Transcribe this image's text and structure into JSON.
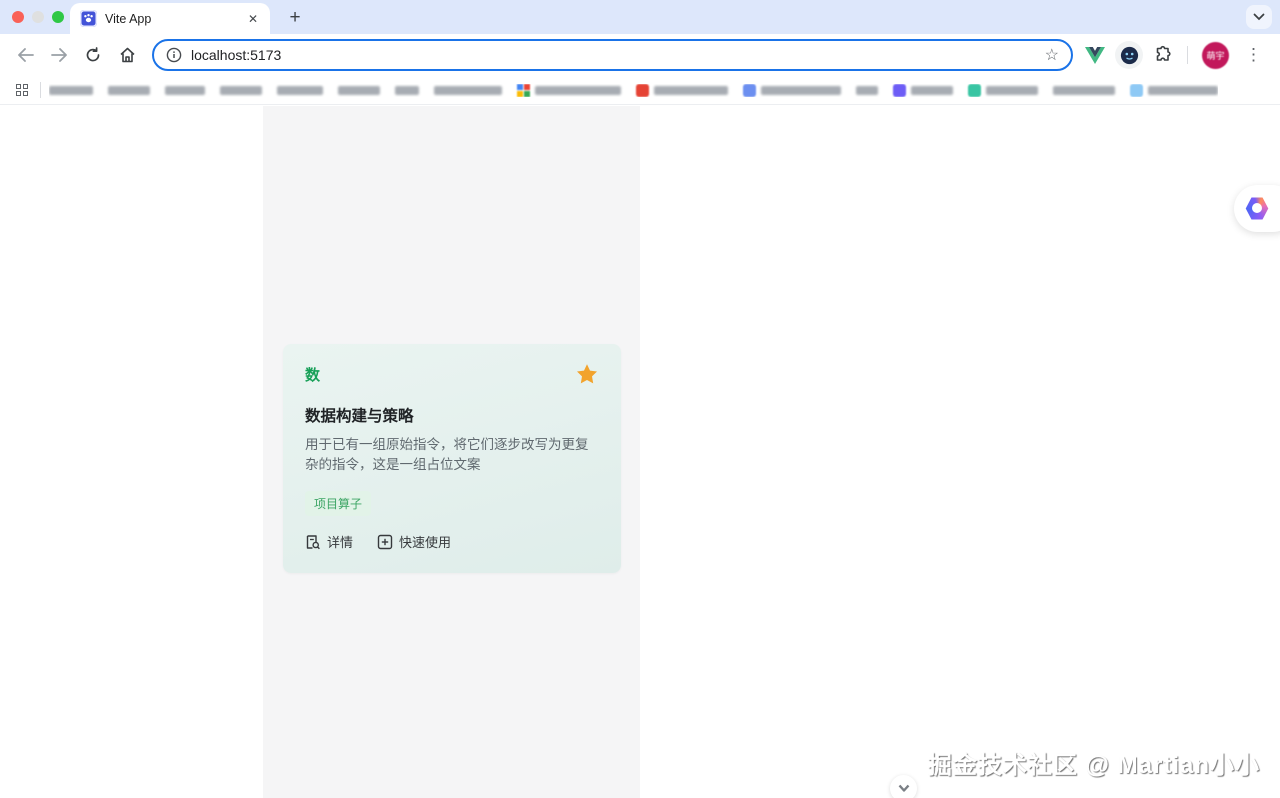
{
  "window": {
    "traffic_lights": [
      "close",
      "minimize",
      "zoom"
    ]
  },
  "tab": {
    "title": "Vite App",
    "close_icon": "✕",
    "new_tab_icon": "+"
  },
  "toolbar": {
    "url": "localhost:5173",
    "bookmark_star_icon": "☆",
    "menu_icon": "⋮",
    "avatar_text": "萌宇"
  },
  "bookmarks": {
    "items": [
      {
        "fav": null,
        "width": 44
      },
      {
        "fav": null,
        "width": 42
      },
      {
        "fav": null,
        "width": 40
      },
      {
        "fav": null,
        "width": 42
      },
      {
        "fav": null,
        "width": 46
      },
      {
        "fav": null,
        "width": 42
      },
      {
        "fav": null,
        "width": 24
      },
      {
        "fav": null,
        "width": 68
      },
      {
        "fav": "multi",
        "width": 86
      },
      {
        "fav": "#e54335",
        "width": 74
      },
      {
        "fav": "#6c8ff0",
        "width": 80
      },
      {
        "fav": null,
        "width": 22
      },
      {
        "fav": "#6d5df6",
        "width": 42
      },
      {
        "fav": "#39c5a3",
        "width": 52
      },
      {
        "fav": null,
        "width": 62
      },
      {
        "fav": "#8ec9f5",
        "width": 70
      }
    ],
    "multi_colors": [
      "#4285F4",
      "#EA4335",
      "#FBBC05",
      "#34A853"
    ]
  },
  "page": {
    "card": {
      "badge": "数",
      "title": "数据构建与策略",
      "description": "用于已有一组原始指令，将它们逐步改写为更复杂的指令，这是一组占位文案",
      "tag": "项目算子",
      "detail_label": "详情",
      "quick_use_label": "快速使用"
    },
    "watermark": "掘金技术社区 @ Martian小小"
  },
  "colors": {
    "accent_green": "#18a058",
    "star_orange": "#f2a32c",
    "tag_bg": "#e2f3e8",
    "card_bg_top": "#eaf4f1",
    "card_bg_bottom": "#dfedea",
    "omnibox_focus": "#1a73e8",
    "tabstrip_bg": "#dde7fb",
    "column_bg": "#f5f5f6",
    "avatar_bg": "#c2185b"
  }
}
